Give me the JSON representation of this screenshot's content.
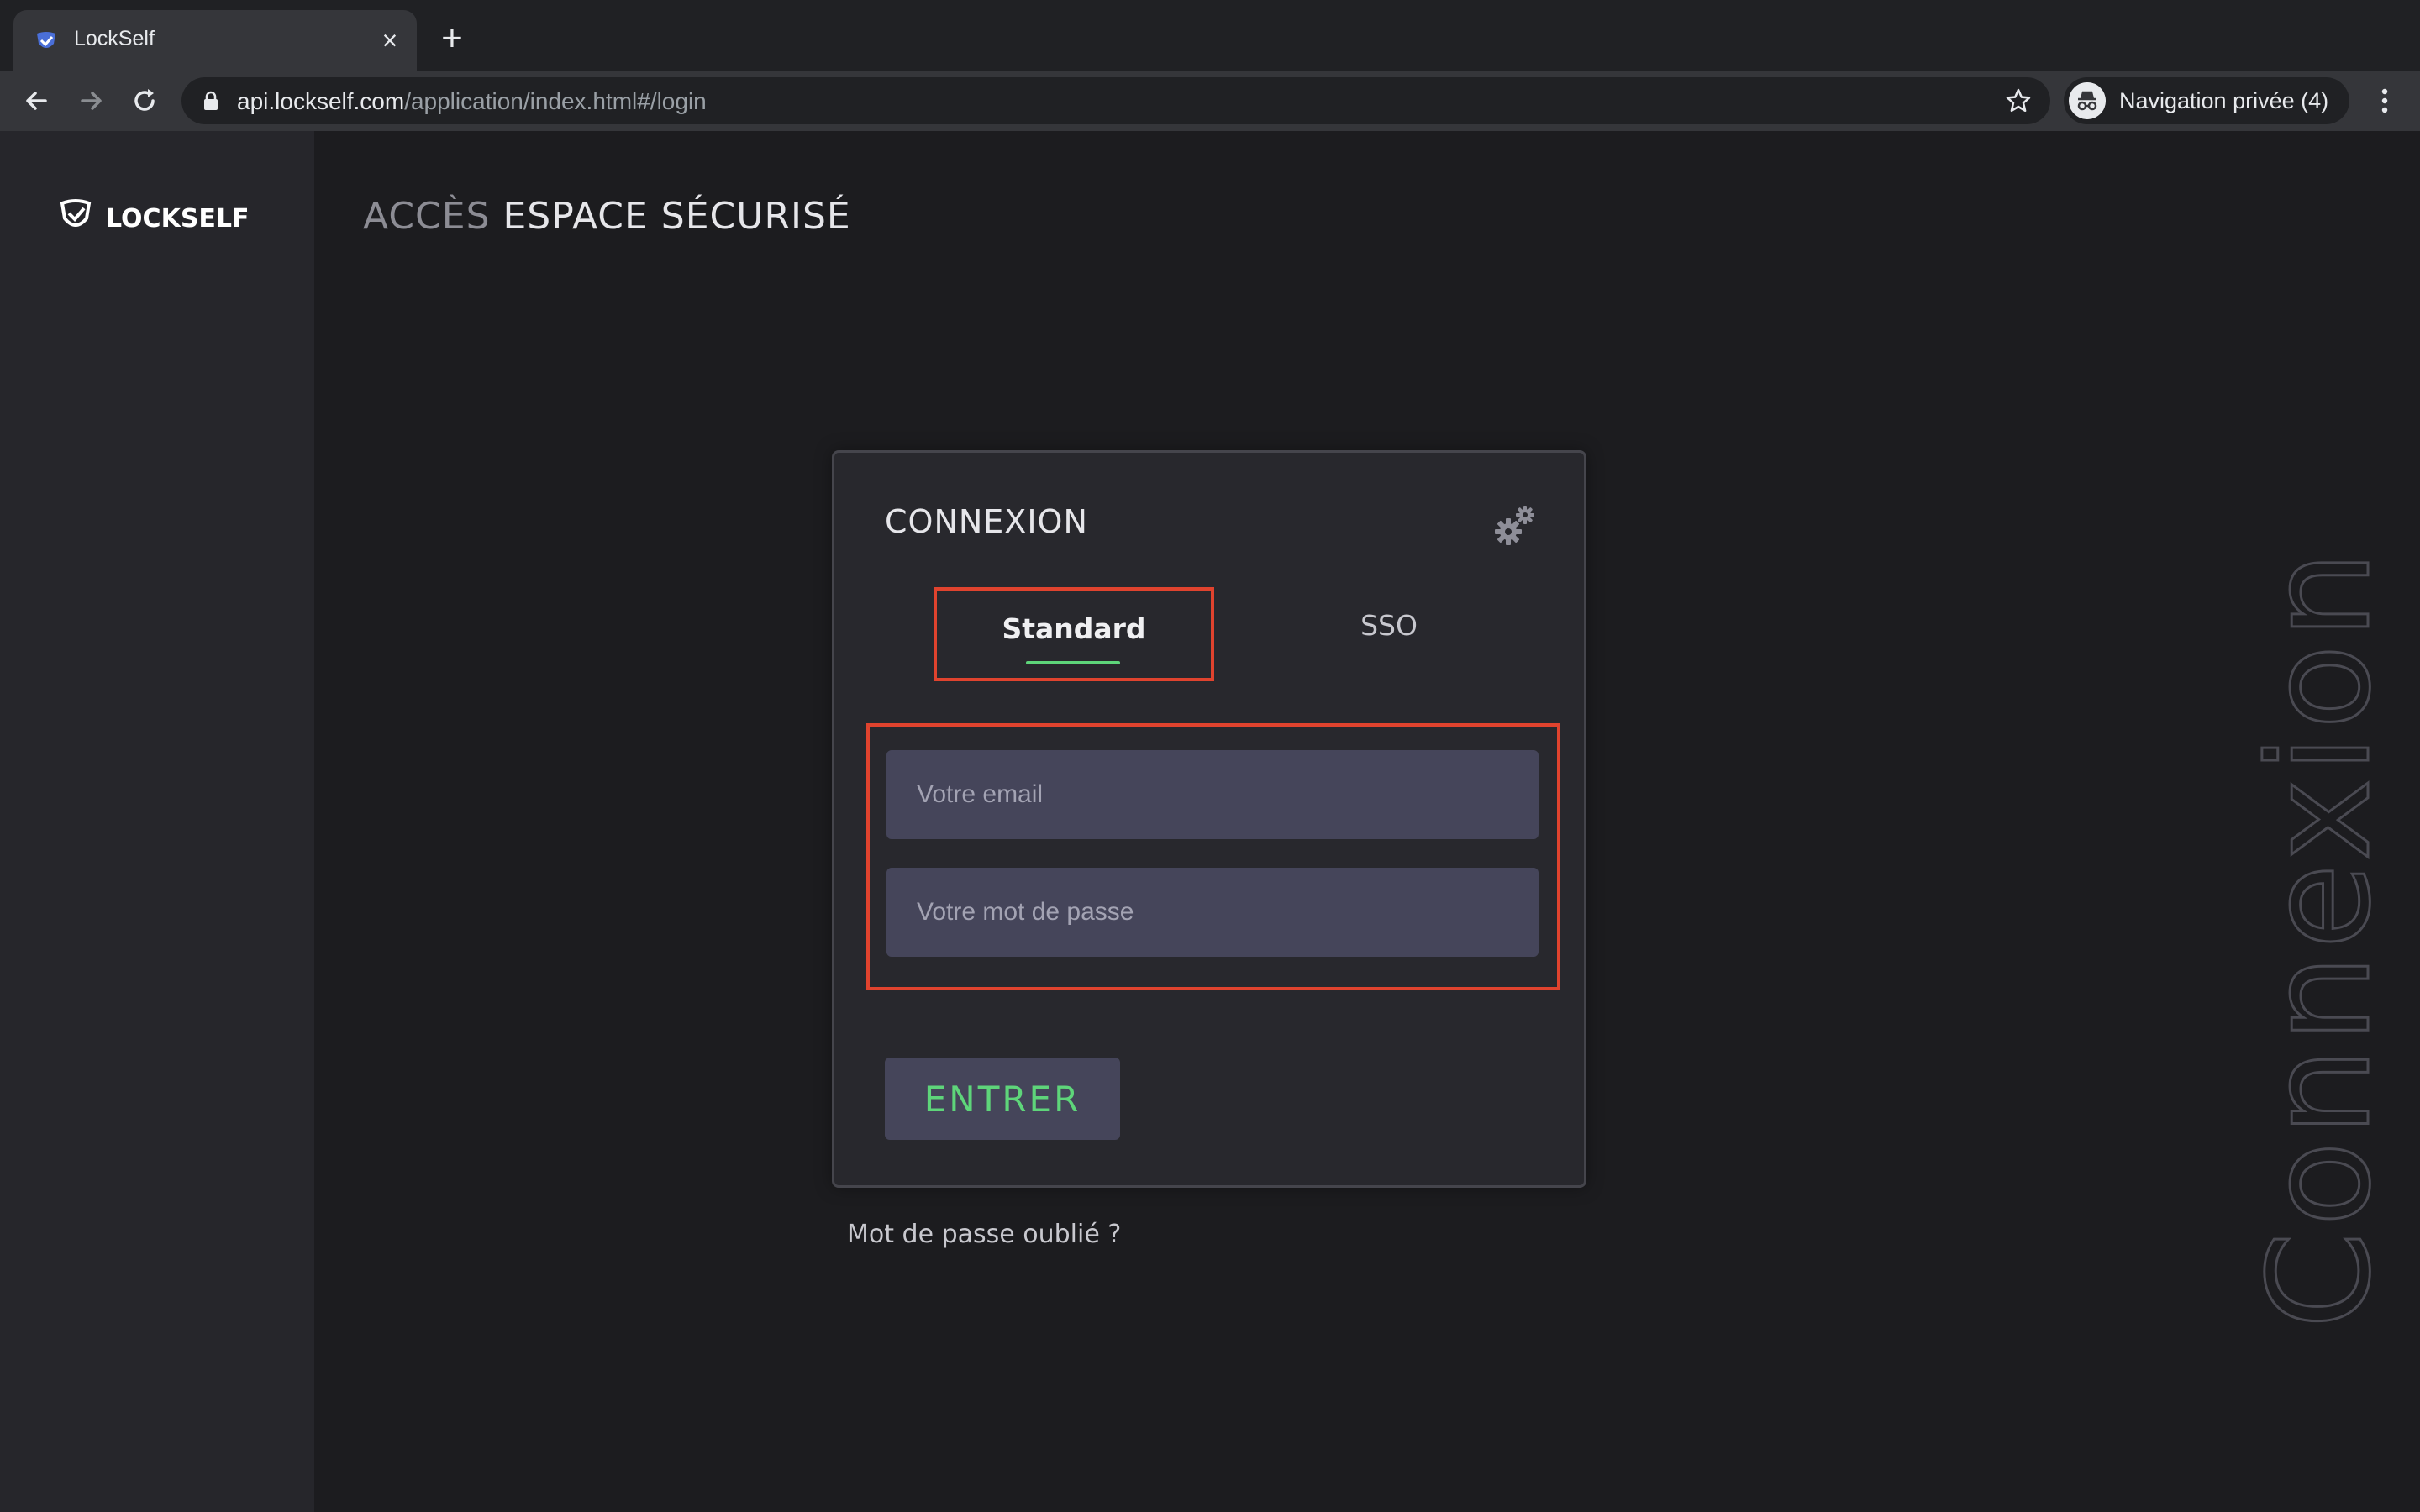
{
  "browser": {
    "tab_title": "LockSelf",
    "url_domain": "api.lockself.com",
    "url_path": "/application/index.html#/login",
    "profile_label": "Navigation privée (4)",
    "icons": [
      "favicon-icon",
      "close-icon",
      "plus-icon",
      "back-arrow-icon",
      "forward-arrow-icon",
      "reload-icon",
      "lock-icon",
      "star-icon",
      "incognito-icon",
      "kebab-menu-icon"
    ]
  },
  "header": {
    "logo_text": "LOCKSELF",
    "title_part1": "ACCÈS",
    "title_part2": " ESPACE SÉCURISÉ"
  },
  "decor": {
    "vertical_word": "Connexion"
  },
  "login": {
    "title": "CONNEXION",
    "tabs": [
      {
        "label": "Standard",
        "active": true
      },
      {
        "label": "SSO",
        "active": false
      }
    ],
    "email_placeholder": "Votre email",
    "password_placeholder": "Votre mot de passe",
    "submit_label": "ENTRER",
    "forgot_label": "Mot de passe oublié ?"
  },
  "colors": {
    "accent_green": "#5ed57a",
    "highlight_red": "#e0432e",
    "field_bg": "#45455a",
    "card_bg": "#28282d"
  }
}
